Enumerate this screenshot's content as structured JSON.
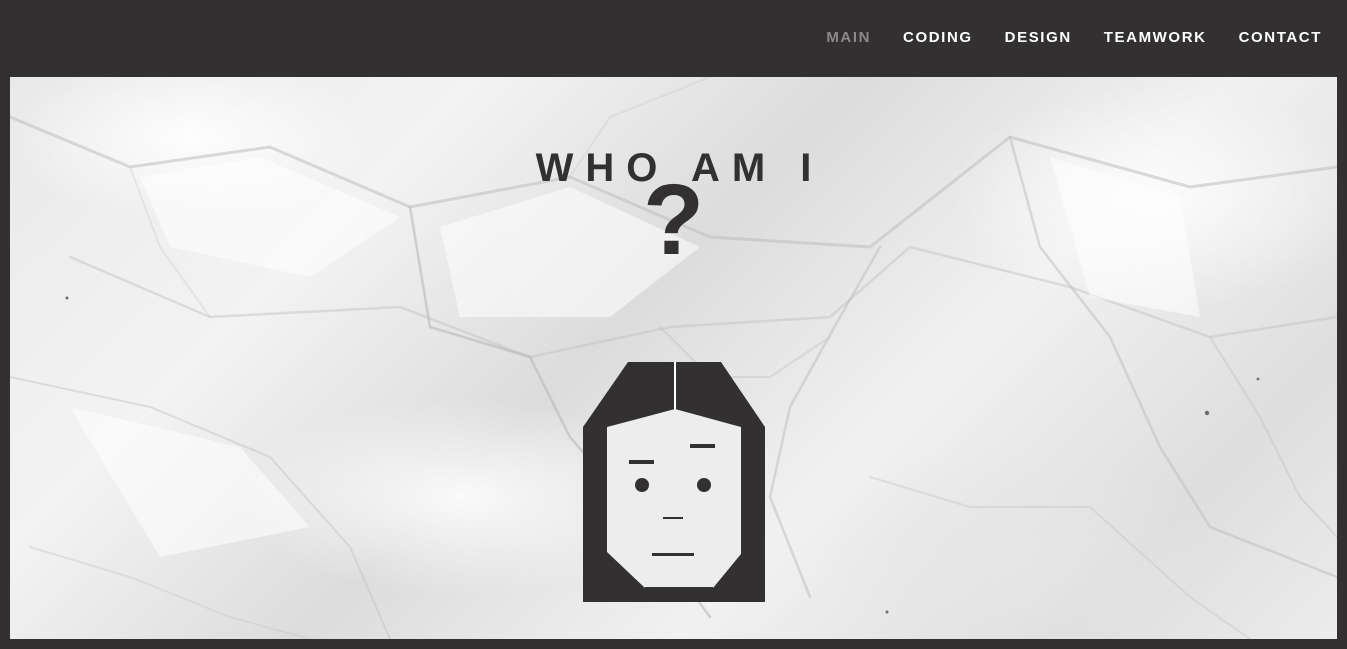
{
  "nav": {
    "items": [
      {
        "label": "MAIN",
        "active": true
      },
      {
        "label": "CODING",
        "active": false
      },
      {
        "label": "DESIGN",
        "active": false
      },
      {
        "label": "TEAMWORK",
        "active": false
      },
      {
        "label": "CONTACT",
        "active": false
      }
    ]
  },
  "hero": {
    "title": "WHO AM I",
    "symbol": "?",
    "illustration": "avatar-face-icon"
  },
  "colors": {
    "dark": "#323031",
    "nav_text": "#ffffff",
    "nav_active": "#8a8889",
    "paper": "#ececec"
  }
}
